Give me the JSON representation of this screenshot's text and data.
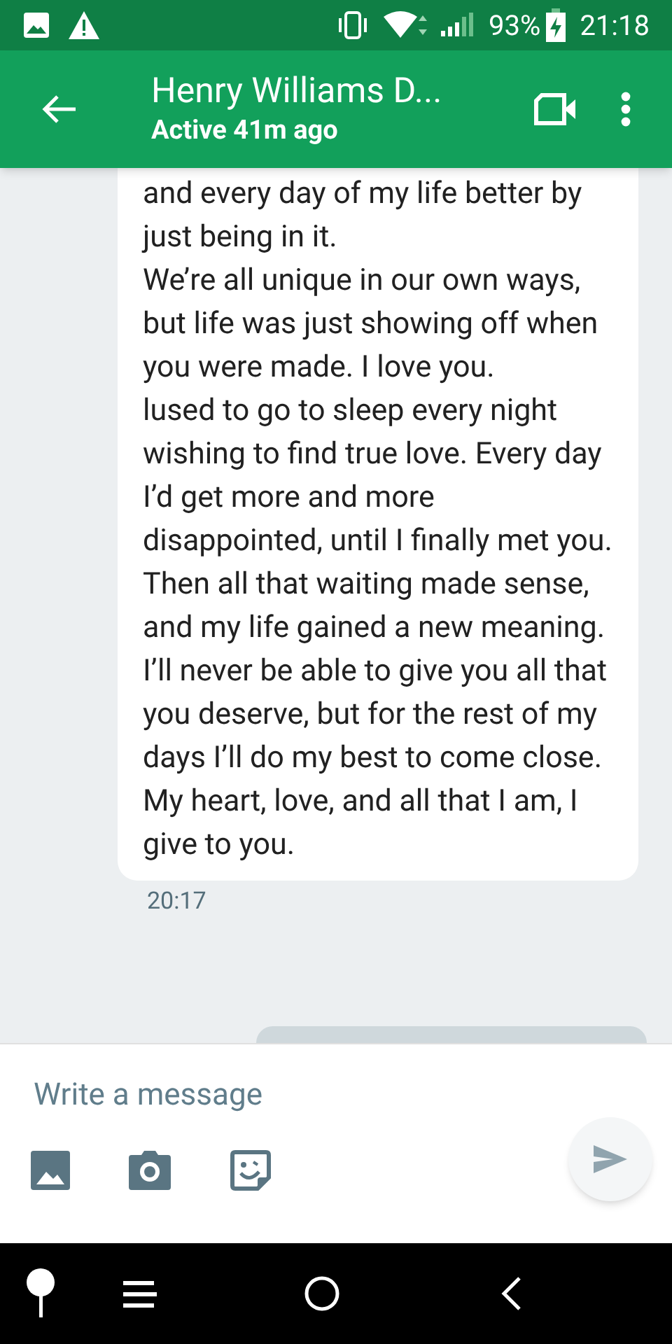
{
  "status_bar": {
    "battery": "93%",
    "time": "21:18"
  },
  "header": {
    "title": "Henry Williams D...",
    "subtitle": "Active 41m ago"
  },
  "messages": [
    {
      "kind": "incoming",
      "paragraphs": [
        "and every day of my life better by just being in it.",
        "We’re all unique in our own ways, but life was just showing off when you were made. I love you.",
        "lused to go to sleep every night wishing to find true love. Every day I’d get more and more disappointed, until I finally met you. Then all that waiting made sense, and my life gained a new meaning.",
        "I’ll never be able to give you all that you deserve, but for the rest of my days I’ll do my best to come close. My heart, love, and all that I am, I give to you."
      ],
      "time": "20:17"
    },
    {
      "kind": "outgoing"
    }
  ],
  "composer": {
    "placeholder": "Write a message"
  }
}
